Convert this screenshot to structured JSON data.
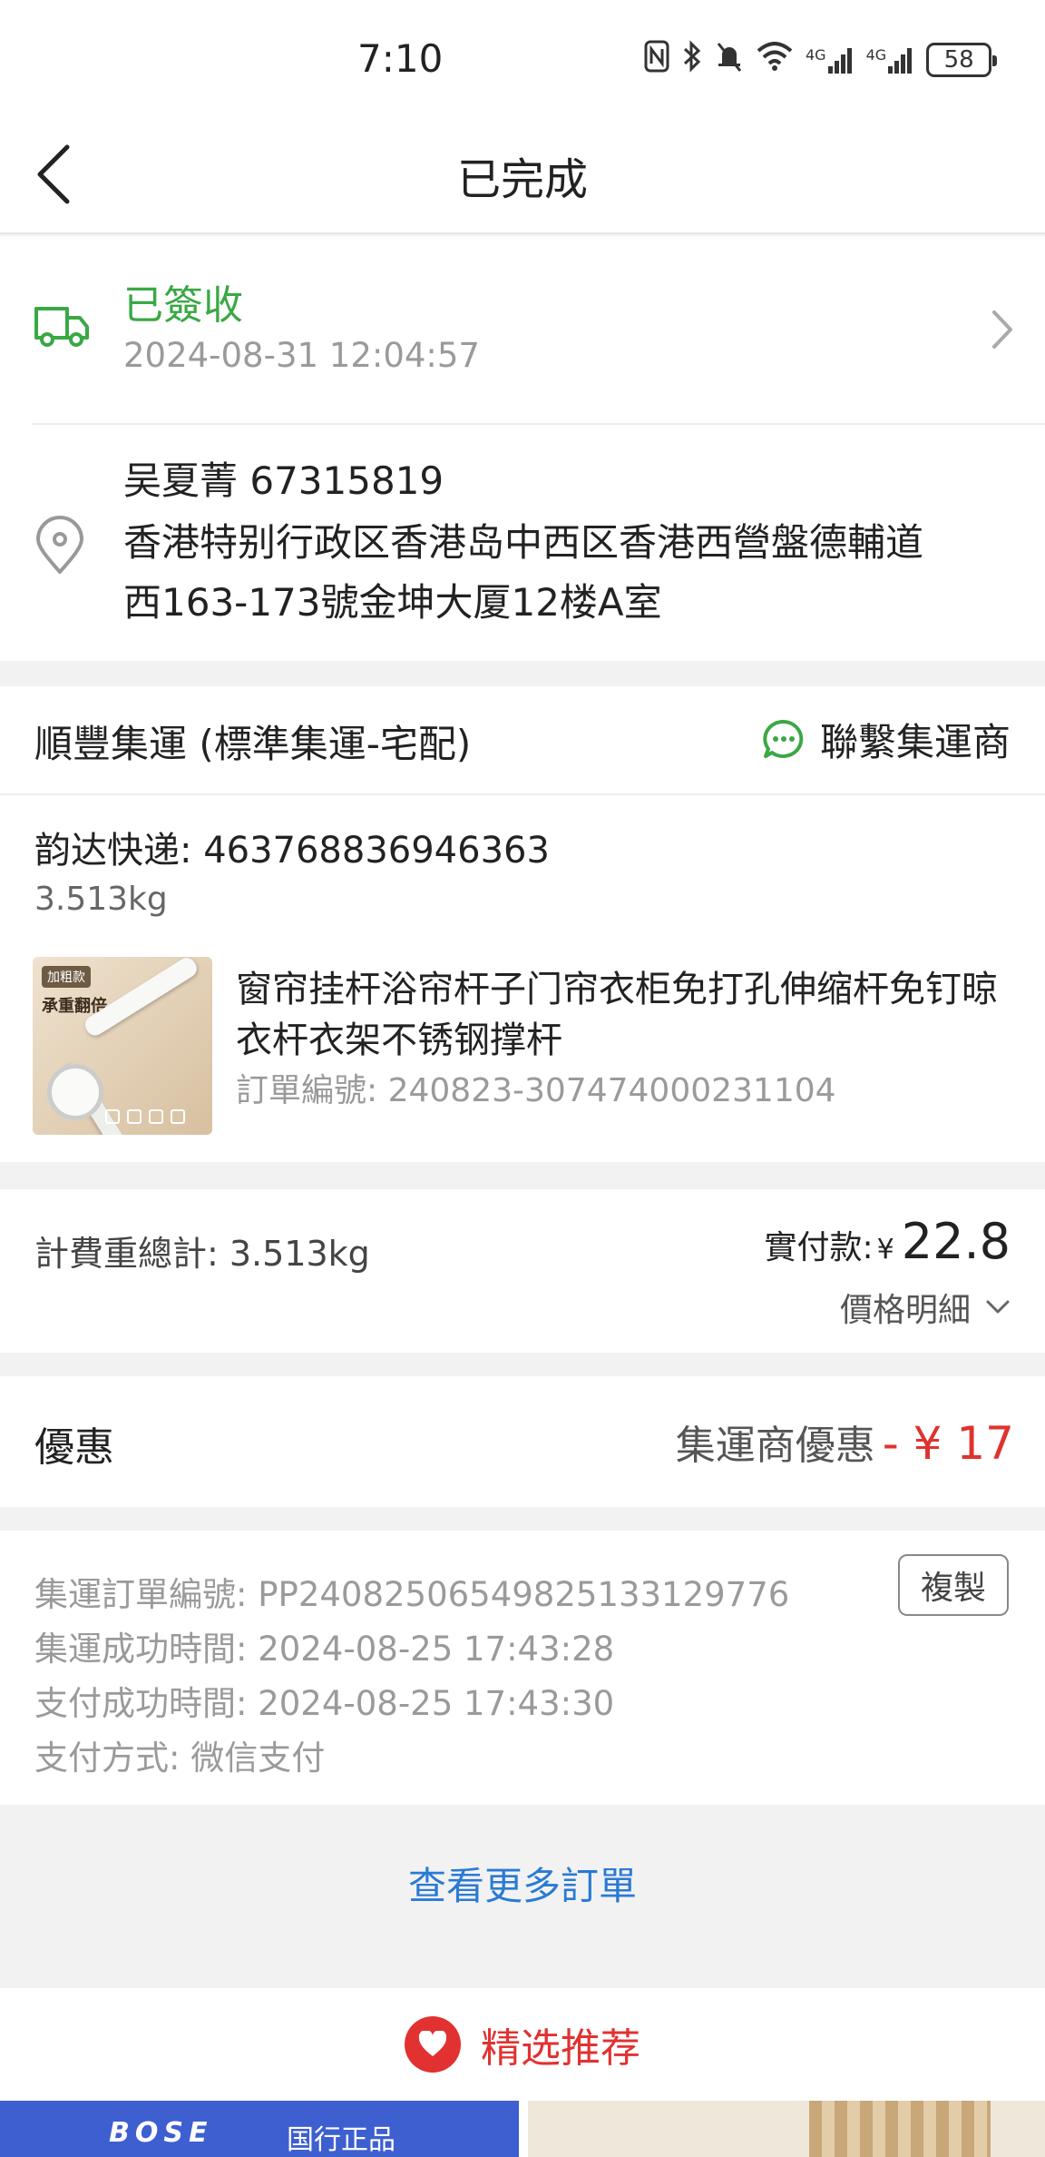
{
  "status_bar": {
    "time": "7:10",
    "signal_1": "4G",
    "signal_2": "4G",
    "battery": "58"
  },
  "nav": {
    "title": "已完成"
  },
  "delivery": {
    "status": "已簽收",
    "time": "2024-08-31 12:04:57"
  },
  "address": {
    "name_phone": "吴夏菁   67315819",
    "line1": "香港特别行政区香港岛中西区香港西營盤德輔道",
    "line2": "西163-173號金坤大厦12楼A室"
  },
  "shipping": {
    "provider": "順豐集運 (標準集運-宅配)",
    "contact_label": "聯繫集運商",
    "tracking": "韵达快递:  463768836946363",
    "weight": "3.513kg",
    "product": {
      "image_tag": "加粗款",
      "image_text": "承重翻倍",
      "name": "窗帘挂杆浴帘杆子门帘衣柜免打孔伸缩杆免钉晾衣杆衣架不锈钢撑杆",
      "order_no": "訂單編號: 240823-307474000231104"
    }
  },
  "fee": {
    "label": "計費重總計:  3.513kg",
    "paid_label": "實付款:",
    "currency": "¥",
    "amount": "22.8",
    "detail_label": "價格明細"
  },
  "discount": {
    "label": "優惠",
    "type": "集運商優惠",
    "value": "- ¥ 17"
  },
  "order_info": {
    "order_no": "集運訂單編號:  PP2408250654982513312977​6",
    "copy_label": "複製",
    "success_time": "集運成功時間:  2024-08-25 17:43:28",
    "pay_time": "支付成功時間:  2024-08-25 17:43:30",
    "pay_method": "支付方式:  微信支付"
  },
  "more_orders": "查看更多訂單",
  "recommend": {
    "title": "精选推荐",
    "tile_brand": "BOSE",
    "tile_sub": "国行正品"
  },
  "colors": {
    "green": "#3aa845",
    "red": "#e0322e",
    "link_blue": "#2a7ad4"
  }
}
